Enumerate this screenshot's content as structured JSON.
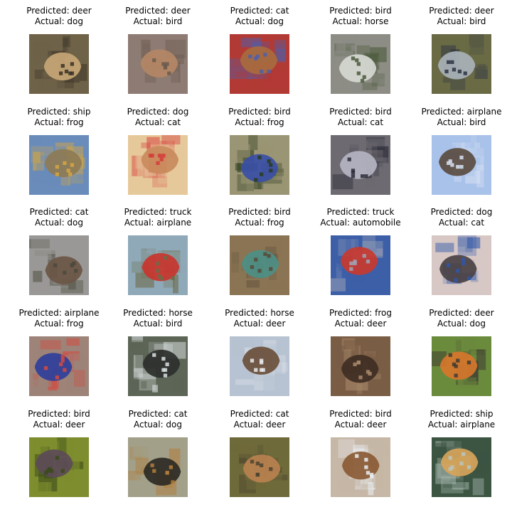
{
  "grid": {
    "items": [
      {
        "predicted": "Predicted: deer",
        "actual": "Actual: dog",
        "subject": "dog",
        "bg": "#6e6248",
        "fg": "#c7a676",
        "accent": "#3a3126"
      },
      {
        "predicted": "Predicted: deer",
        "actual": "Actual: bird",
        "subject": "bird",
        "bg": "#8e7c74",
        "fg": "#b48765",
        "accent": "#6c5a4e"
      },
      {
        "predicted": "Predicted: cat",
        "actual": "Actual: dog",
        "subject": "dog",
        "bg": "#b23a35",
        "fg": "#a86b3e",
        "accent": "#4f5fa8"
      },
      {
        "predicted": "Predicted: bird",
        "actual": "Actual: horse",
        "subject": "horse",
        "bg": "#8d8d86",
        "fg": "#d6d8d2",
        "accent": "#4b5a3b"
      },
      {
        "predicted": "Predicted: deer",
        "actual": "Actual: bird",
        "subject": "bird",
        "bg": "#6a6b45",
        "fg": "#a9b2b8",
        "accent": "#2d3342"
      },
      {
        "predicted": "Predicted: ship",
        "actual": "Actual: frog",
        "subject": "frog",
        "bg": "#6a8cbb",
        "fg": "#8d7b55",
        "accent": "#d6a63f"
      },
      {
        "predicted": "Predicted: dog",
        "actual": "Actual: cat",
        "subject": "cat",
        "bg": "#e6c99a",
        "fg": "#c98b5c",
        "accent": "#d53a3a"
      },
      {
        "predicted": "Predicted: bird",
        "actual": "Actual: frog",
        "subject": "frog",
        "bg": "#9a9574",
        "fg": "#3a4fa6",
        "accent": "#2c3c1e"
      },
      {
        "predicted": "Predicted: bird",
        "actual": "Actual: cat",
        "subject": "cat",
        "bg": "#6e6a72",
        "fg": "#b4b4c2",
        "accent": "#2b2d38"
      },
      {
        "predicted": "Predicted: airplane",
        "actual": "Actual: bird",
        "subject": "bird",
        "bg": "#a9c2ea",
        "fg": "#5a4c40",
        "accent": "#d9e2f4"
      },
      {
        "predicted": "Predicted: cat",
        "actual": "Actual: dog",
        "subject": "dog",
        "bg": "#9a9896",
        "fg": "#6b5645",
        "accent": "#4a4a3c"
      },
      {
        "predicted": "Predicted: truck",
        "actual": "Actual: airplane",
        "subject": "airplane",
        "bg": "#8fa9b8",
        "fg": "#c8352e",
        "accent": "#6d6b47"
      },
      {
        "predicted": "Predicted: bird",
        "actual": "Actual: frog",
        "subject": "frog",
        "bg": "#8a7454",
        "fg": "#4d8f86",
        "accent": "#574937"
      },
      {
        "predicted": "Predicted: truck",
        "actual": "Actual: automobile",
        "subject": "automobile",
        "bg": "#3c5fa8",
        "fg": "#c93a2f",
        "accent": "#9fa4b6"
      },
      {
        "predicted": "Predicted: dog",
        "actual": "Actual: cat",
        "subject": "cat",
        "bg": "#d7c8c6",
        "fg": "#4a4144",
        "accent": "#2f57a8"
      },
      {
        "predicted": "Predicted: airplane",
        "actual": "Actual: frog",
        "subject": "frog",
        "bg": "#9d8378",
        "fg": "#2f3f9a",
        "accent": "#d54a3f"
      },
      {
        "predicted": "Predicted: horse",
        "actual": "Actual: bird",
        "subject": "bird",
        "bg": "#5c6556",
        "fg": "#2c2f2c",
        "accent": "#d9dfe0"
      },
      {
        "predicted": "Predicted: horse",
        "actual": "Actual: deer",
        "subject": "deer",
        "bg": "#b7c3d2",
        "fg": "#6a4f3b",
        "accent": "#e7ebf0"
      },
      {
        "predicted": "Predicted: frog",
        "actual": "Actual: deer",
        "subject": "deer",
        "bg": "#7a5d45",
        "fg": "#3f2e24",
        "accent": "#a88a6a"
      },
      {
        "predicted": "Predicted: deer",
        "actual": "Actual: dog",
        "subject": "dog",
        "bg": "#6a8a3c",
        "fg": "#d6762c",
        "accent": "#3e3a33"
      },
      {
        "predicted": "Predicted: bird",
        "actual": "Actual: deer",
        "subject": "deer",
        "bg": "#7e8d2e",
        "fg": "#5c4b57",
        "accent": "#3a4a1a"
      },
      {
        "predicted": "Predicted: cat",
        "actual": "Actual: dog",
        "subject": "dog",
        "bg": "#a3a08a",
        "fg": "#2d2a24",
        "accent": "#b07c3a"
      },
      {
        "predicted": "Predicted: cat",
        "actual": "Actual: deer",
        "subject": "deer",
        "bg": "#6f6a3a",
        "fg": "#b8814f",
        "accent": "#4b4430"
      },
      {
        "predicted": "Predicted: bird",
        "actual": "Actual: deer",
        "subject": "deer",
        "bg": "#c6b7a6",
        "fg": "#8a5a34",
        "accent": "#e9eef3"
      },
      {
        "predicted": "Predicted: ship",
        "actual": "Actual: airplane",
        "subject": "airplane",
        "bg": "#3c5442",
        "fg": "#d7a55a",
        "accent": "#b8c6c0"
      }
    ]
  }
}
